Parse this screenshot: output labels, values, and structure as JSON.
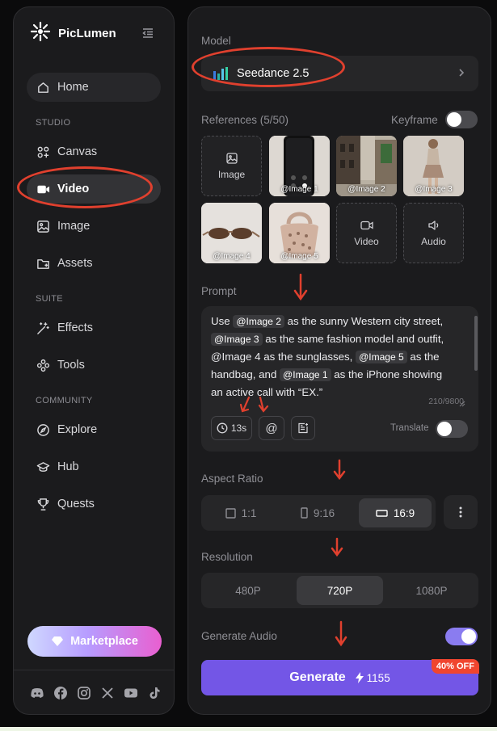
{
  "brand": {
    "name": "PicLumen"
  },
  "sidebar": {
    "home": "Home",
    "studio_label": "STUDIO",
    "canvas": "Canvas",
    "video": "Video",
    "image": "Image",
    "assets": "Assets",
    "suite_label": "SUITE",
    "effects": "Effects",
    "tools": "Tools",
    "community_label": "COMMUNITY",
    "explore": "Explore",
    "hub": "Hub",
    "quests": "Quests",
    "marketplace": "Marketplace"
  },
  "main": {
    "model_label": "Model",
    "model_value": "Seedance 2.5",
    "references_label": "References (5/50)",
    "keyframe_label": "Keyframe",
    "keyframe_on": false,
    "ref_tiles": {
      "image_btn": "Image",
      "video_btn": "Video",
      "audio_btn": "Audio",
      "img1": "@Image 1",
      "img2": "@Image 2",
      "img3": "@Image 3",
      "img4": "@Image 4",
      "img5": "@Image 5"
    },
    "prompt_label": "Prompt",
    "prompt": {
      "t1": "Use ",
      "c1": "@Image 2",
      "t2": " as the sunny Western city street, ",
      "c2": "@Image 3",
      "t3": " as the same fashion model and outfit, @Image 4 as the sunglasses, ",
      "c3": "@Image 5",
      "t4": " as the handbag, and ",
      "c4": "@Image 1",
      "t5": " as the iPhone showing an active call with “EX.”"
    },
    "char_count": "210/9800",
    "duration": "13s",
    "at_symbol": "@",
    "translate_label": "Translate",
    "translate_on": false,
    "aspect_label": "Aspect Ratio",
    "aspect_options": [
      "1:1",
      "9:16",
      "16:9"
    ],
    "aspect_selected": "16:9",
    "resolution_label": "Resolution",
    "resolution_options": [
      "480P",
      "720P",
      "1080P"
    ],
    "resolution_selected": "720P",
    "audio_label": "Generate Audio",
    "audio_on": true,
    "generate_label": "Generate",
    "generate_cost": "1155",
    "discount_badge": "40% OFF"
  },
  "colors": {
    "accent": "#7356e6",
    "toggle_on": "#8a7cf0",
    "badge": "#f0452f",
    "annotation": "#e0402e"
  },
  "icons": [
    "sparkle-logo-icon",
    "collapse-icon",
    "home-icon",
    "canvas-icon",
    "video-icon",
    "image-icon",
    "assets-icon",
    "effects-icon",
    "tools-icon",
    "explore-icon",
    "hub-icon",
    "quests-icon",
    "diamond-icon",
    "discord-icon",
    "facebook-icon",
    "instagram-icon",
    "x-icon",
    "youtube-icon",
    "tiktok-icon",
    "seedance-logo-icon",
    "chevron-right-icon",
    "clock-icon",
    "at-icon",
    "note-add-icon",
    "more-vertical-icon",
    "lightning-icon"
  ]
}
